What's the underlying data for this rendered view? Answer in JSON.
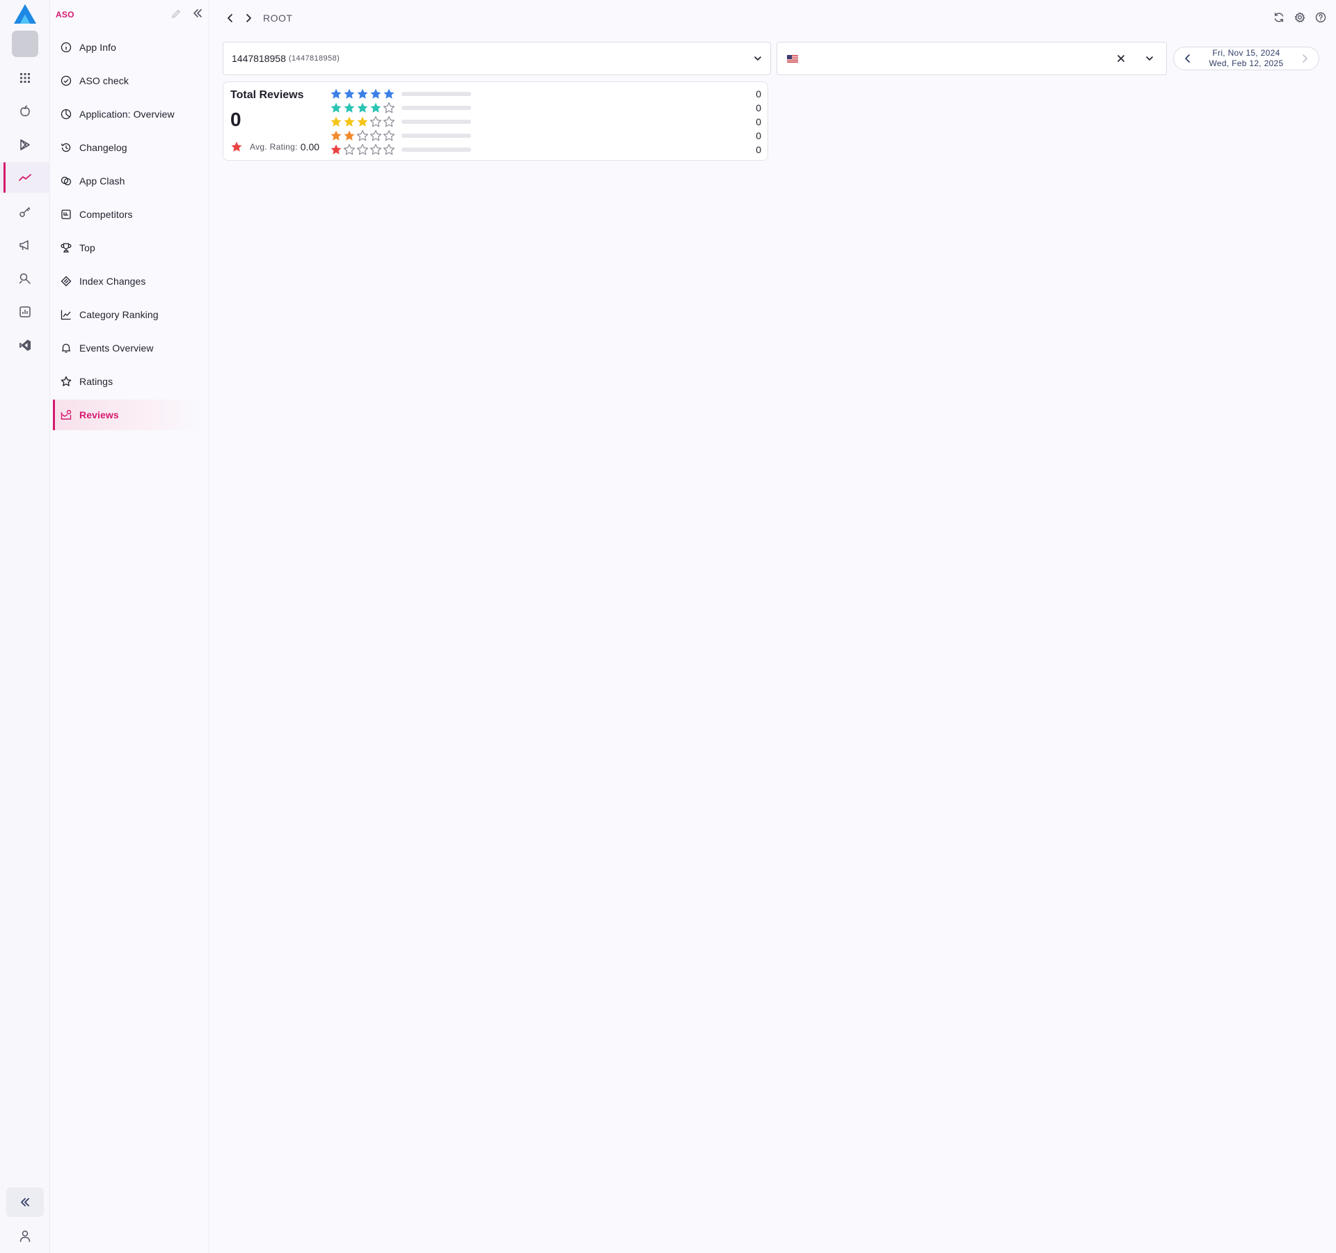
{
  "colors": {
    "accent": "#d61a6e",
    "star_5": "#3b7fe8",
    "star_4": "#2bc4b4",
    "star_3": "#f5c518",
    "star_2": "#f28a2e",
    "star_1": "#e94343",
    "star_empty": "#8b8b97"
  },
  "rail": {
    "logo_icon": "app-logo-icon",
    "items": [
      {
        "icon": "apps-grid-icon"
      },
      {
        "icon": "apple-icon"
      },
      {
        "icon": "google-play-icon"
      },
      {
        "icon": "trend-icon",
        "active": true
      },
      {
        "icon": "key-icon"
      },
      {
        "icon": "megaphone-icon"
      },
      {
        "icon": "search-tools-icon"
      },
      {
        "icon": "report-icon"
      },
      {
        "icon": "vscode-icon"
      }
    ],
    "collapse_icon": "double-chevron-left-icon",
    "user_icon": "user-icon"
  },
  "sidebar": {
    "title": "ASO",
    "items": [
      {
        "label": "App Info",
        "icon": "info-icon"
      },
      {
        "label": "ASO check",
        "icon": "check-circle-icon"
      },
      {
        "label": "Application: Overview",
        "icon": "pie-chart-icon"
      },
      {
        "label": "Changelog",
        "icon": "history-icon"
      },
      {
        "label": "App Clash",
        "icon": "clash-icon"
      },
      {
        "label": "Competitors",
        "icon": "competitors-icon"
      },
      {
        "label": "Top",
        "icon": "trophy-icon"
      },
      {
        "label": "Index Changes",
        "icon": "index-icon"
      },
      {
        "label": "Category Ranking",
        "icon": "line-chart-icon"
      },
      {
        "label": "Events Overview",
        "icon": "bell-icon"
      },
      {
        "label": "Ratings",
        "icon": "star-outline-icon"
      },
      {
        "label": "Reviews",
        "icon": "reviews-icon",
        "active": true
      }
    ]
  },
  "topbar": {
    "breadcrumb": "ROOT",
    "actions": [
      "refresh-icon",
      "settings-icon",
      "help-icon"
    ]
  },
  "filters": {
    "app_id": "1447818958",
    "app_id_sub": "(1447818958)",
    "country_value": "",
    "date_start": "Fri, Nov 15, 2024",
    "date_end": "Wed, Feb 12, 2025"
  },
  "reviews": {
    "title": "Total Reviews",
    "total": "0",
    "avg_label": "Avg. Rating:",
    "avg_value": "0.00",
    "rows": [
      {
        "stars": 5,
        "count": "0",
        "fraction": 0
      },
      {
        "stars": 4,
        "count": "0",
        "fraction": 0
      },
      {
        "stars": 3,
        "count": "0",
        "fraction": 0
      },
      {
        "stars": 2,
        "count": "0",
        "fraction": 0
      },
      {
        "stars": 1,
        "count": "0",
        "fraction": 0
      }
    ]
  }
}
